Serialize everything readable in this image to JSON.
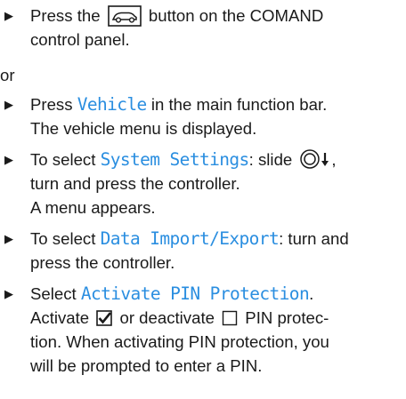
{
  "steps": [
    {
      "line1_before": "Press the",
      "button_icon": "vehicle-button-icon",
      "line1_after": "button on the COMAND",
      "line2": "control panel."
    }
  ],
  "or": "or",
  "step_vehicle": {
    "before": "Press",
    "keyword": "Vehicle",
    "after": "in the main function bar.",
    "line2": "The vehicle menu is displayed."
  },
  "step_system": {
    "before": "To select",
    "keyword": "System Settings",
    "after": ": slide",
    "controller_icon": "controller-slide-down-icon",
    "after2": ",",
    "line2": "turn and press the controller.",
    "line3": "A menu appears."
  },
  "step_data": {
    "before": "To select",
    "keyword": "Data Import/Export",
    "after": ": turn and",
    "line2": "press the controller."
  },
  "step_pin": {
    "before": "Select",
    "keyword": "Activate PIN Protection",
    "after": ".",
    "line2_a": "Activate",
    "checked_icon": "checkbox-checked-icon",
    "line2_b": "or deactivate",
    "unchecked_icon": "checkbox-unchecked-icon",
    "line2_c": "PIN protec-",
    "line3": "tion. When activating PIN protection, you",
    "line4": "will be prompted to enter a PIN."
  },
  "bullet_glyph": "▶"
}
